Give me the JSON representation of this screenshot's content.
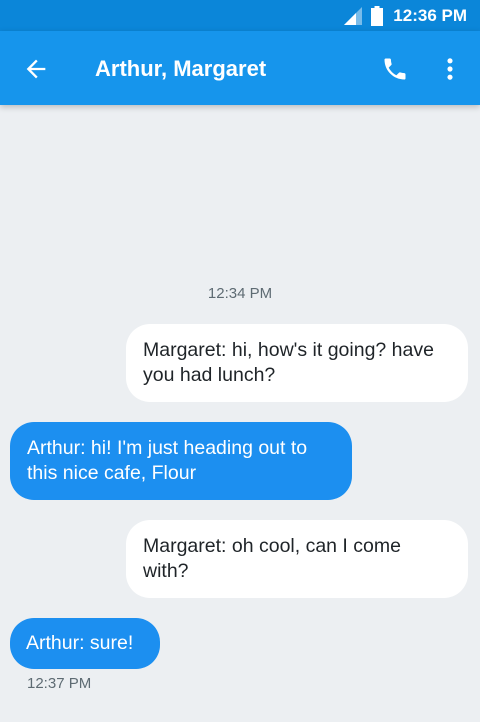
{
  "status_bar": {
    "time": "12:36 PM"
  },
  "app_bar": {
    "title": "Arthur, Margaret",
    "icons": [
      "back-arrow-icon",
      "phone-icon",
      "more-vert-icon"
    ]
  },
  "thread": {
    "timestamp_top": "12:34 PM",
    "messages": [
      {
        "direction": "incoming",
        "text": "Margaret: hi, how's it going? have you had lunch?"
      },
      {
        "direction": "outgoing",
        "text": "Arthur: hi! I'm just heading out to this nice cafe, Flour"
      },
      {
        "direction": "incoming",
        "text": "Margaret: oh cool, can I come with?"
      },
      {
        "direction": "outgoing",
        "text": "Arthur: sure!"
      }
    ],
    "timestamp_last": "12:37 PM"
  },
  "colors": {
    "status_bar": "#0b86d9",
    "app_bar": "#1695ec",
    "background": "#eceff2",
    "outgoing_bubble": "#1c8ff0",
    "incoming_bubble": "#ffffff"
  }
}
